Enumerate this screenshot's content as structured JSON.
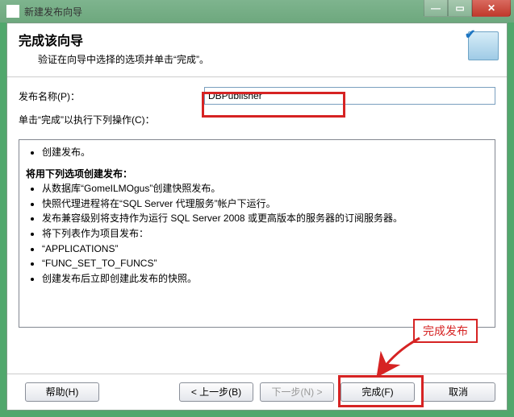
{
  "window": {
    "title": "新建发布向导",
    "min": "—",
    "max": "▭",
    "close": "✕"
  },
  "header": {
    "title": "完成该向导",
    "subtitle": "验证在向导中选择的选项并单击“完成”。"
  },
  "form": {
    "publish_label": "发布名称(P)：",
    "publish_value": "DBPublisher",
    "instruction": "单击“完成”以执行下列操作(C)："
  },
  "summary": {
    "line1": "创建发布。",
    "heading": "将用下列选项创建发布：",
    "opt1": "从数据库“GomeILMOgus”创建快照发布。",
    "opt2": "快照代理进程将在“SQL Server 代理服务”帐户下运行。",
    "opt3": "发布兼容级别将支持作为运行 SQL Server 2008 或更高版本的服务器的订阅服务器。",
    "opt4": "将下列表作为项目发布：",
    "tbl1": "“APPLICATIONS”",
    "tbl2": "“FUNC_SET_TO_FUNCS”",
    "opt5": "创建发布后立即创建此发布的快照。"
  },
  "buttons": {
    "help": "帮助(H)",
    "back": "< 上一步(B)",
    "next": "下一步(N) >",
    "finish": "完成(F)",
    "cancel": "取消"
  },
  "annotation": {
    "label": "完成发布"
  }
}
